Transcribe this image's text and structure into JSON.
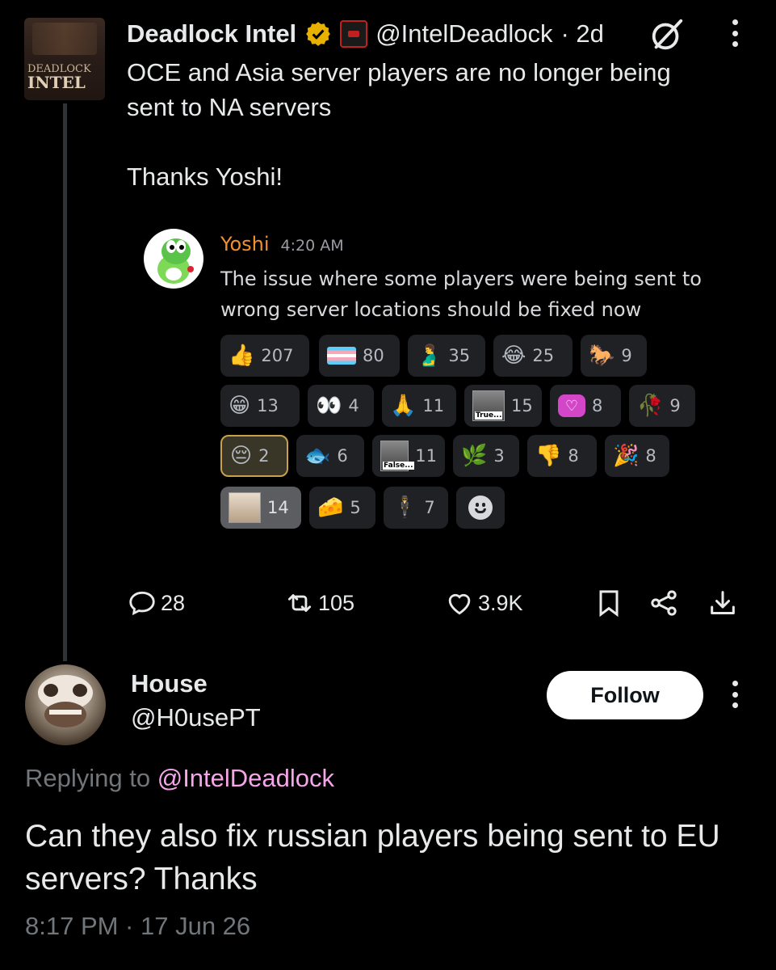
{
  "parent_tweet": {
    "author_name": "Deadlock Intel",
    "avatar_text_line1": "DEADLOCK",
    "avatar_text_line2": "INTEL",
    "handle": "@IntelDeadlock",
    "time": "· 2d",
    "text_line1": "OCE and Asia server players are no longer being",
    "text_line2": "sent to NA servers",
    "text_line3": "Thanks Yoshi!",
    "embed": {
      "author": "Yoshi",
      "time": "4:20 AM",
      "text_line1": "The issue where some players were being sent to",
      "text_line2": "wrong server locations should be fixed now",
      "reactions": [
        {
          "emoji": "👍",
          "count": "207"
        },
        {
          "emoji": "trans-flag",
          "count": "80"
        },
        {
          "emoji": "🫃",
          "count": "35"
        },
        {
          "emoji": "😂",
          "count": "25"
        },
        {
          "emoji": "🐎",
          "count": "9"
        },
        {
          "emoji": "😁",
          "count": "13"
        },
        {
          "emoji": "👀",
          "count": "4"
        },
        {
          "emoji": "🙏",
          "count": "11"
        },
        {
          "emoji": "true-image",
          "label": "True...",
          "count": "15"
        },
        {
          "emoji": "💟",
          "count": "8"
        },
        {
          "emoji": "🥀",
          "count": "9"
        },
        {
          "emoji": "😔",
          "count": "2"
        },
        {
          "emoji": "🐟",
          "count": "6"
        },
        {
          "emoji": "false-image",
          "label": "False...",
          "count": "11"
        },
        {
          "emoji": "🌿",
          "count": "3"
        },
        {
          "emoji": "👎",
          "count": "8"
        },
        {
          "emoji": "🎉",
          "count": "8"
        },
        {
          "emoji": "hamster-image",
          "count": "14"
        },
        {
          "emoji": "🧀",
          "count": "5"
        },
        {
          "emoji": "🕴",
          "count": "7"
        }
      ]
    },
    "actions": {
      "replies": "28",
      "reposts": "105",
      "likes": "3.9K"
    }
  },
  "reply_tweet": {
    "author_name": "House",
    "handle": "@H0usePT",
    "follow_label": "Follow",
    "replying_prefix": "Replying to",
    "replying_mention": "@IntelDeadlock",
    "text_line1": "Can they also fix russian players being sent to EU",
    "text_line2": "servers? Thanks",
    "timestamp": "8:17 PM · 17 Jun 26"
  },
  "colors": {
    "background": "#000000",
    "text": "#e7e9ea",
    "muted": "#71767b",
    "verified_gold": "#e8b100",
    "mention_pink": "#f4a6e8",
    "yoshi_orange": "#f48f2b"
  }
}
